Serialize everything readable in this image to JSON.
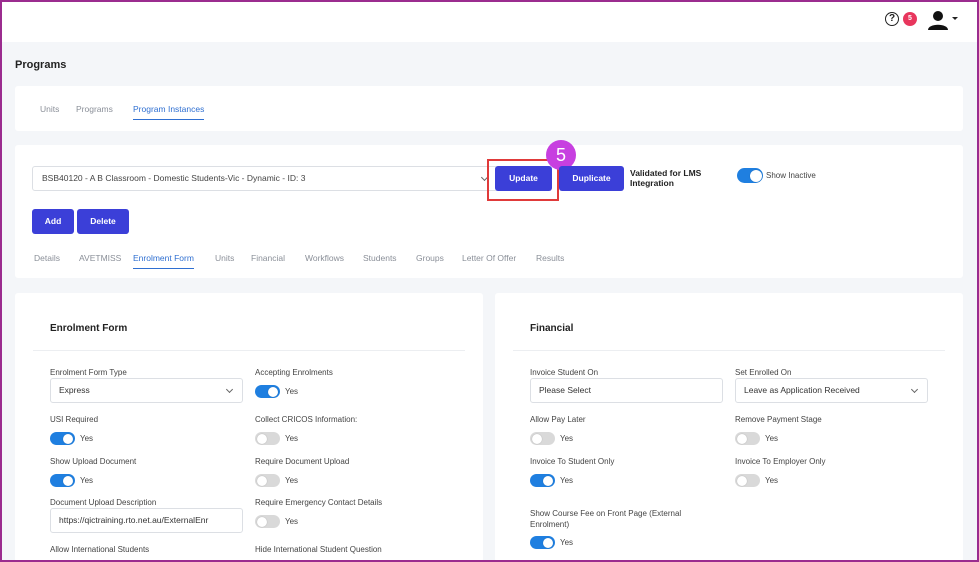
{
  "header": {
    "help_icon": "question-circle-icon",
    "notification_count": "5",
    "avatar_icon": "user-icon"
  },
  "page": {
    "title": "Programs"
  },
  "top_tabs": [
    "Units",
    "Programs",
    "Program Instances"
  ],
  "instance": {
    "selected": "BSB40120 - A B Classroom - Domestic Students-Vic - Dynamic - ID: 3",
    "update_label": "Update",
    "duplicate_label": "Duplicate",
    "validated_label": "Validated for LMS Integration",
    "show_inactive_label": "Show Inactive",
    "step_number": "5",
    "add_label": "Add",
    "delete_label": "Delete"
  },
  "sub_tabs": [
    "Details",
    "AVETMISS",
    "Enrolment Form",
    "Units",
    "Financial",
    "Workflows",
    "Students",
    "Groups",
    "Letter Of Offer",
    "Results"
  ],
  "enrolment_form": {
    "title": "Enrolment Form",
    "form_type_label": "Enrolment Form Type",
    "form_type_value": "Express",
    "accepting_label": "Accepting Enrolments",
    "usi_label": "USI Required",
    "cricos_label": "Collect CRICOS Information:",
    "show_upload_label": "Show Upload Document",
    "require_upload_label": "Require Document Upload",
    "doc_desc_label": "Document Upload Description",
    "doc_desc_value": "https://qictraining.rto.net.au/ExternalEnr",
    "emergency_label": "Require Emergency Contact Details",
    "intl_label": "Allow International Students",
    "hide_intl_label": "Hide International Student Question",
    "yes": "Yes"
  },
  "financial": {
    "title": "Financial",
    "invoice_on_label": "Invoice Student On",
    "invoice_on_placeholder": "Please Select",
    "set_enrolled_label": "Set Enrolled On",
    "set_enrolled_value": "Leave as Application Received",
    "pay_later_label": "Allow Pay Later",
    "remove_payment_label": "Remove Payment Stage",
    "invoice_student_only_label": "Invoice To Student Only",
    "invoice_employer_only_label": "Invoice To Employer Only",
    "show_course_fee_label": "Show Course Fee on Front Page (External Enrolment)",
    "yes": "Yes"
  },
  "colors": {
    "primary": "#3b3fd8",
    "toggle_on": "#1f7fe0",
    "link_active": "#2f6fd1",
    "highlight": "#e03a3a",
    "step_badge": "#c73fe0",
    "notification": "#e8365d"
  }
}
